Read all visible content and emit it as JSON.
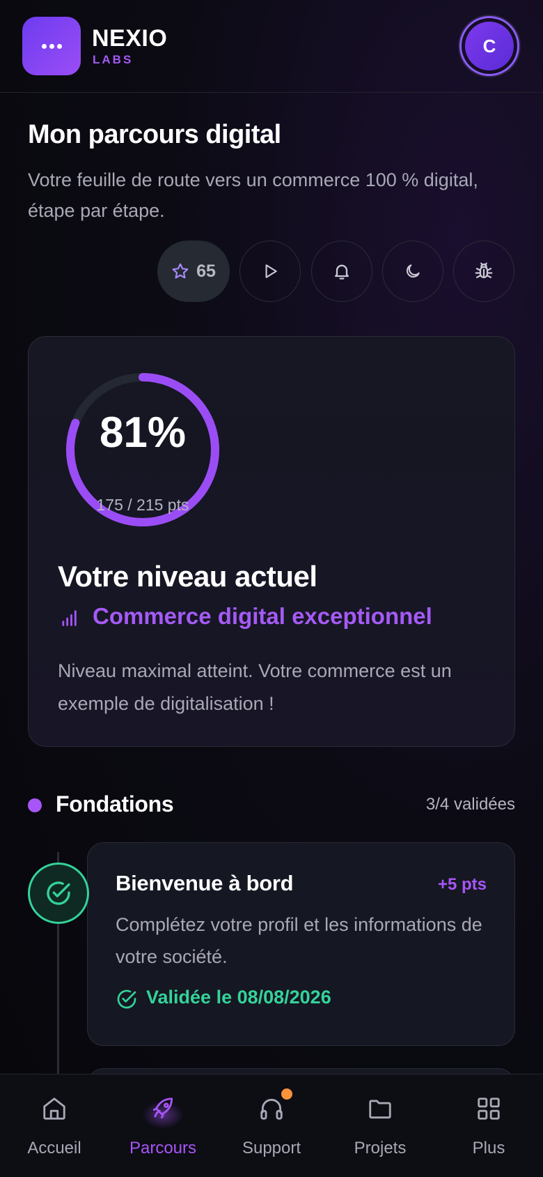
{
  "header": {
    "brand_name": "NEXIO",
    "brand_sub": "LABS",
    "avatar_initial": "C",
    "logo_icon": "more-dots-icon"
  },
  "page": {
    "title": "Mon parcours digital",
    "subtitle": "Votre feuille de route vers un commerce 100 % digital, étape par étape."
  },
  "actions": {
    "stars_count": "65",
    "icons": [
      "star-icon",
      "play-icon",
      "bell-icon",
      "moon-icon",
      "bug-icon"
    ]
  },
  "level_card": {
    "percent_label": "81%",
    "progress_fraction": 0.81,
    "points_label": "175 / 215 pts",
    "heading": "Votre niveau actuel",
    "level_name": "Commerce digital exceptionnel",
    "description": "Niveau maximal atteint. Votre commerce est un exemple de digitalisation !"
  },
  "section": {
    "title": "Fondations",
    "count": "3/4 validées"
  },
  "steps": [
    {
      "title": "Bienvenue à bord",
      "points": "+5 pts",
      "description": "Complétez votre profil et les informations de votre société.",
      "status": "Validée le 08/08/2026"
    }
  ],
  "nav": {
    "items": [
      {
        "label": "Accueil",
        "icon": "home-icon"
      },
      {
        "label": "Parcours",
        "icon": "rocket-icon",
        "active": true
      },
      {
        "label": "Support",
        "icon": "headphones-icon",
        "badge": true
      },
      {
        "label": "Projets",
        "icon": "folder-icon"
      },
      {
        "label": "Plus",
        "icon": "grid-icon"
      }
    ]
  },
  "colors": {
    "accent": "#a855f7",
    "success": "#34d399",
    "badge": "#fb923c",
    "background": "#0c0b14"
  }
}
